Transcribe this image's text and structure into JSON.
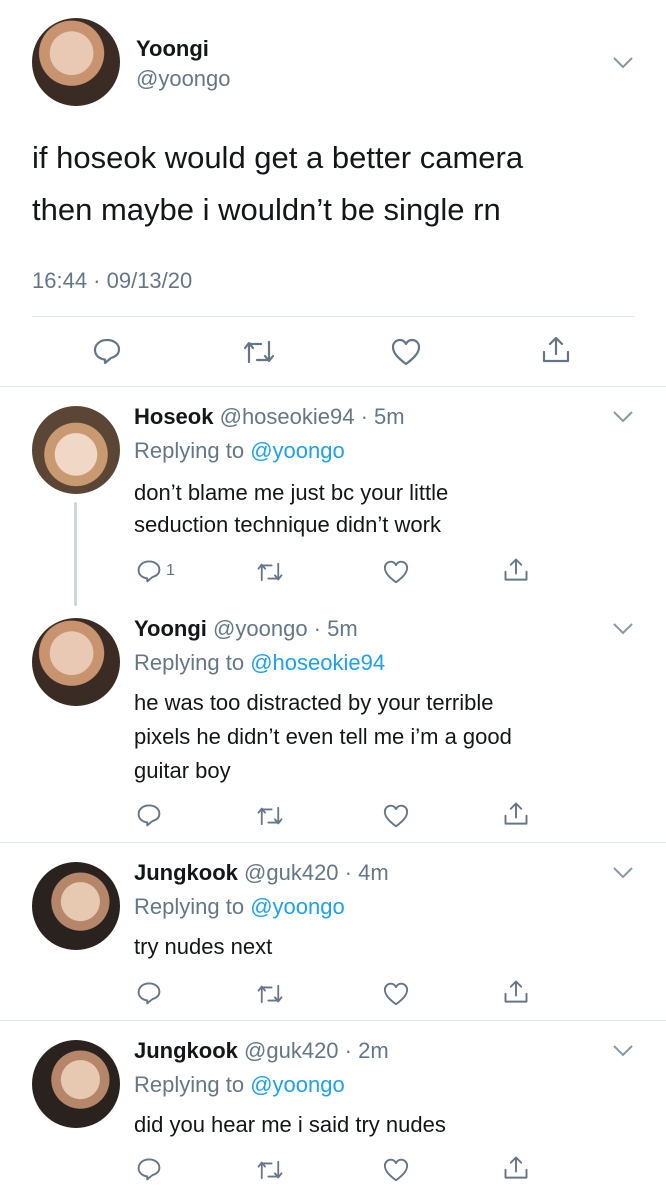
{
  "main_tweet": {
    "display_name": "Yoongi",
    "handle": "@yoongo",
    "text_line1": "if hoseok would get a better camera",
    "text_line2": "then maybe i wouldn’t be single rn",
    "timestamp": "16:44 · 09/13/20",
    "actions": [
      "reply-icon",
      "retweet-icon",
      "like-icon",
      "share-icon"
    ]
  },
  "replies": [
    {
      "display_name": "Hoseok",
      "meta": "@hoseokie94 · 5m",
      "replying_prefix": "Replying to ",
      "replying_to": "@yoongo",
      "text_line1": "don’t blame me just bc your little",
      "text_line2": "seduction technique didn’t work",
      "reply_count": "1"
    },
    {
      "display_name": "Yoongi",
      "meta": "@yoongo · 5m",
      "replying_prefix": "Replying to ",
      "replying_to": "@hoseokie94",
      "text_line1": "he was too distracted by your terrible",
      "text_line2": "pixels he didn’t even tell me i’m a good",
      "text_line3": "guitar boy"
    },
    {
      "display_name": "Jungkook",
      "meta": "@guk420 · 4m",
      "replying_prefix": "Replying to ",
      "replying_to": "@yoongo",
      "text_line1": "try nudes next"
    },
    {
      "display_name": "Jungkook",
      "meta": "@guk420 · 2m",
      "replying_prefix": "Replying to ",
      "replying_to": "@yoongo",
      "text_line1": "did you hear me i said try nudes"
    }
  ],
  "colors": {
    "link": "#1da1f2",
    "muted": "#657786",
    "divider": "#e1e8ed"
  }
}
